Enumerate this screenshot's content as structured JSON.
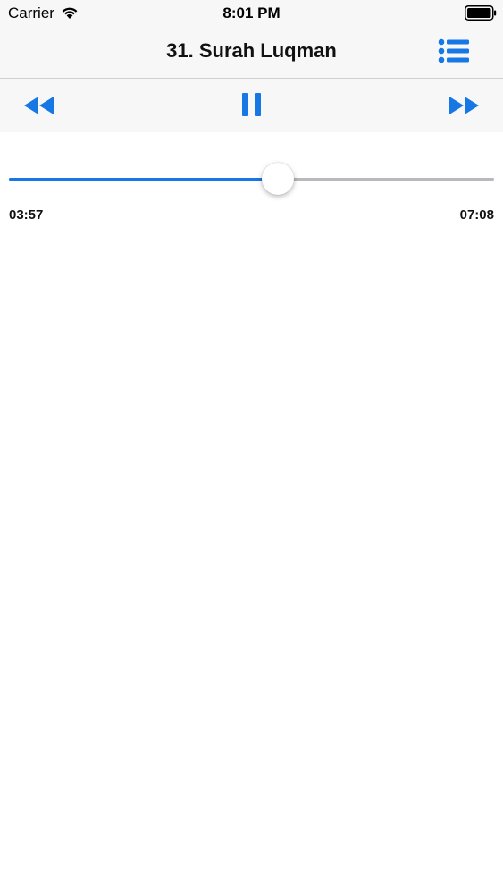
{
  "status_bar": {
    "carrier": "Carrier",
    "time": "8:01 PM",
    "wifi_icon": "wifi-icon",
    "battery_icon": "battery-icon"
  },
  "nav": {
    "title": "31. Surah Luqman",
    "playlist_icon": "list-icon"
  },
  "controls": {
    "rewind_icon": "rewind-icon",
    "pause_icon": "pause-icon",
    "forward_icon": "fast-forward-icon"
  },
  "progress": {
    "elapsed": "03:57",
    "total": "07:08",
    "fraction": 0.5537
  },
  "colors": {
    "accent": "#1677e5",
    "bar_background": "#f7f7f8",
    "track": "#b8b8bd"
  }
}
